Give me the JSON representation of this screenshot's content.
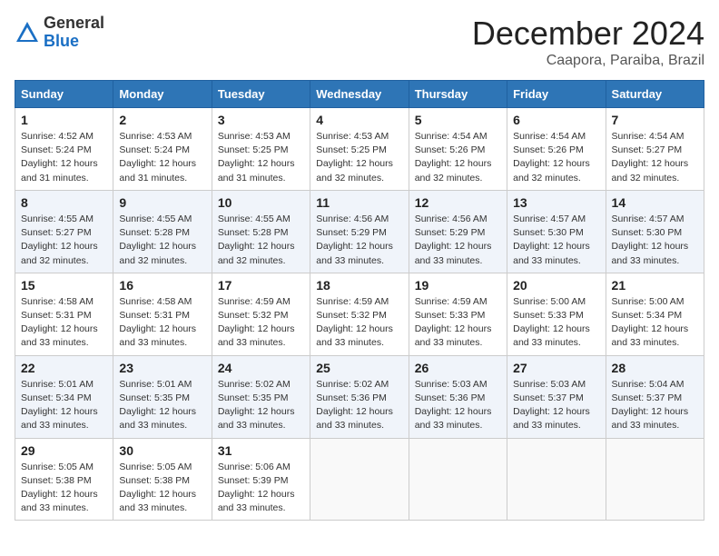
{
  "header": {
    "logo_general": "General",
    "logo_blue": "Blue",
    "month_title": "December 2024",
    "location": "Caapora, Paraiba, Brazil"
  },
  "calendar": {
    "weekdays": [
      "Sunday",
      "Monday",
      "Tuesday",
      "Wednesday",
      "Thursday",
      "Friday",
      "Saturday"
    ],
    "weeks": [
      [
        {
          "day": "",
          "info": ""
        },
        {
          "day": "2",
          "info": "Sunrise: 4:53 AM\nSunset: 5:24 PM\nDaylight: 12 hours\nand 31 minutes."
        },
        {
          "day": "3",
          "info": "Sunrise: 4:53 AM\nSunset: 5:25 PM\nDaylight: 12 hours\nand 31 minutes."
        },
        {
          "day": "4",
          "info": "Sunrise: 4:53 AM\nSunset: 5:25 PM\nDaylight: 12 hours\nand 32 minutes."
        },
        {
          "day": "5",
          "info": "Sunrise: 4:54 AM\nSunset: 5:26 PM\nDaylight: 12 hours\nand 32 minutes."
        },
        {
          "day": "6",
          "info": "Sunrise: 4:54 AM\nSunset: 5:26 PM\nDaylight: 12 hours\nand 32 minutes."
        },
        {
          "day": "7",
          "info": "Sunrise: 4:54 AM\nSunset: 5:27 PM\nDaylight: 12 hours\nand 32 minutes."
        }
      ],
      [
        {
          "day": "1",
          "info": "Sunrise: 4:52 AM\nSunset: 5:24 PM\nDaylight: 12 hours\nand 31 minutes."
        },
        {
          "day": "",
          "info": ""
        },
        {
          "day": "",
          "info": ""
        },
        {
          "day": "",
          "info": ""
        },
        {
          "day": "",
          "info": ""
        },
        {
          "day": "",
          "info": ""
        },
        {
          "day": "",
          "info": ""
        }
      ],
      [
        {
          "day": "8",
          "info": "Sunrise: 4:55 AM\nSunset: 5:27 PM\nDaylight: 12 hours\nand 32 minutes."
        },
        {
          "day": "9",
          "info": "Sunrise: 4:55 AM\nSunset: 5:28 PM\nDaylight: 12 hours\nand 32 minutes."
        },
        {
          "day": "10",
          "info": "Sunrise: 4:55 AM\nSunset: 5:28 PM\nDaylight: 12 hours\nand 32 minutes."
        },
        {
          "day": "11",
          "info": "Sunrise: 4:56 AM\nSunset: 5:29 PM\nDaylight: 12 hours\nand 33 minutes."
        },
        {
          "day": "12",
          "info": "Sunrise: 4:56 AM\nSunset: 5:29 PM\nDaylight: 12 hours\nand 33 minutes."
        },
        {
          "day": "13",
          "info": "Sunrise: 4:57 AM\nSunset: 5:30 PM\nDaylight: 12 hours\nand 33 minutes."
        },
        {
          "day": "14",
          "info": "Sunrise: 4:57 AM\nSunset: 5:30 PM\nDaylight: 12 hours\nand 33 minutes."
        }
      ],
      [
        {
          "day": "15",
          "info": "Sunrise: 4:58 AM\nSunset: 5:31 PM\nDaylight: 12 hours\nand 33 minutes."
        },
        {
          "day": "16",
          "info": "Sunrise: 4:58 AM\nSunset: 5:31 PM\nDaylight: 12 hours\nand 33 minutes."
        },
        {
          "day": "17",
          "info": "Sunrise: 4:59 AM\nSunset: 5:32 PM\nDaylight: 12 hours\nand 33 minutes."
        },
        {
          "day": "18",
          "info": "Sunrise: 4:59 AM\nSunset: 5:32 PM\nDaylight: 12 hours\nand 33 minutes."
        },
        {
          "day": "19",
          "info": "Sunrise: 4:59 AM\nSunset: 5:33 PM\nDaylight: 12 hours\nand 33 minutes."
        },
        {
          "day": "20",
          "info": "Sunrise: 5:00 AM\nSunset: 5:33 PM\nDaylight: 12 hours\nand 33 minutes."
        },
        {
          "day": "21",
          "info": "Sunrise: 5:00 AM\nSunset: 5:34 PM\nDaylight: 12 hours\nand 33 minutes."
        }
      ],
      [
        {
          "day": "22",
          "info": "Sunrise: 5:01 AM\nSunset: 5:34 PM\nDaylight: 12 hours\nand 33 minutes."
        },
        {
          "day": "23",
          "info": "Sunrise: 5:01 AM\nSunset: 5:35 PM\nDaylight: 12 hours\nand 33 minutes."
        },
        {
          "day": "24",
          "info": "Sunrise: 5:02 AM\nSunset: 5:35 PM\nDaylight: 12 hours\nand 33 minutes."
        },
        {
          "day": "25",
          "info": "Sunrise: 5:02 AM\nSunset: 5:36 PM\nDaylight: 12 hours\nand 33 minutes."
        },
        {
          "day": "26",
          "info": "Sunrise: 5:03 AM\nSunset: 5:36 PM\nDaylight: 12 hours\nand 33 minutes."
        },
        {
          "day": "27",
          "info": "Sunrise: 5:03 AM\nSunset: 5:37 PM\nDaylight: 12 hours\nand 33 minutes."
        },
        {
          "day": "28",
          "info": "Sunrise: 5:04 AM\nSunset: 5:37 PM\nDaylight: 12 hours\nand 33 minutes."
        }
      ],
      [
        {
          "day": "29",
          "info": "Sunrise: 5:05 AM\nSunset: 5:38 PM\nDaylight: 12 hours\nand 33 minutes."
        },
        {
          "day": "30",
          "info": "Sunrise: 5:05 AM\nSunset: 5:38 PM\nDaylight: 12 hours\nand 33 minutes."
        },
        {
          "day": "31",
          "info": "Sunrise: 5:06 AM\nSunset: 5:39 PM\nDaylight: 12 hours\nand 33 minutes."
        },
        {
          "day": "",
          "info": ""
        },
        {
          "day": "",
          "info": ""
        },
        {
          "day": "",
          "info": ""
        },
        {
          "day": "",
          "info": ""
        }
      ]
    ]
  }
}
